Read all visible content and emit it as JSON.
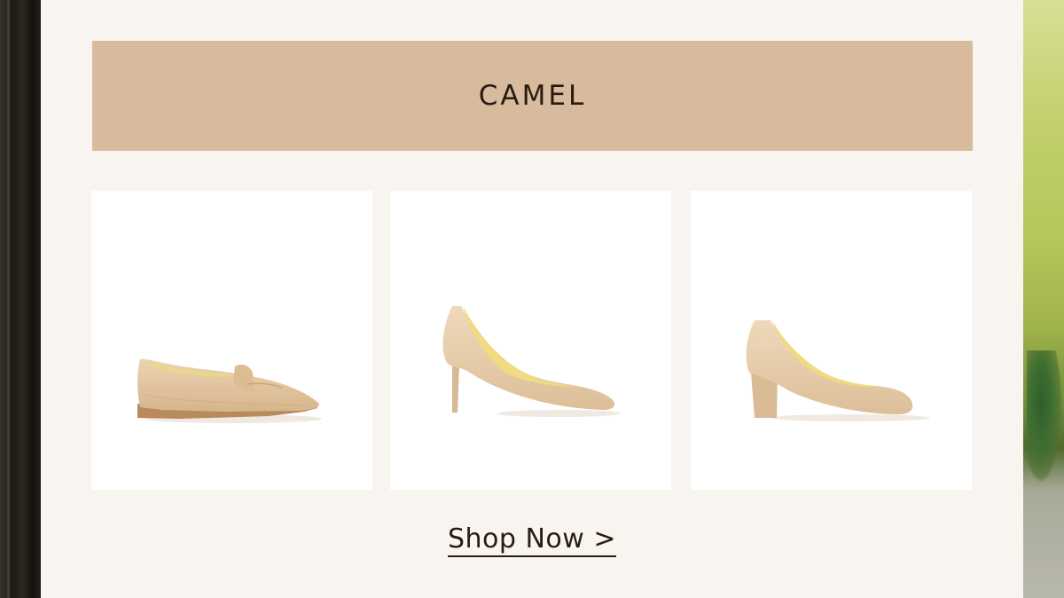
{
  "banner": {
    "title": "CAMEL"
  },
  "products": [
    {
      "name": "loafer",
      "icon": "loafer-shoe-icon"
    },
    {
      "name": "stiletto-pump",
      "icon": "stiletto-pump-icon"
    },
    {
      "name": "block-heel-pump",
      "icon": "block-heel-pump-icon"
    }
  ],
  "cta": {
    "label": "Shop Now >"
  },
  "colors": {
    "banner_bg": "#d7bb9c",
    "text": "#2b1a12",
    "panel_bg": "#f8f5f1",
    "suede": "#e1c7a3"
  }
}
